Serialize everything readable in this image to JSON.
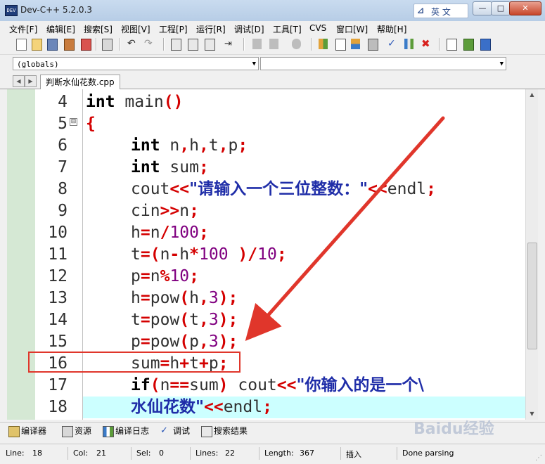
{
  "window": {
    "title": "Dev-C++ 5.2.0.3",
    "app_icon_text": "DEV",
    "ime_label": "英 文",
    "min": "—",
    "max": "□",
    "close": "✕"
  },
  "menu": [
    "文件[F]",
    "编辑[E]",
    "搜索[S]",
    "视图[V]",
    "工程[P]",
    "运行[R]",
    "调试[D]",
    "工具[T]",
    "CVS",
    "窗口[W]",
    "帮助[H]"
  ],
  "scope": {
    "class_combo": "(globals)",
    "member_combo": ""
  },
  "tabs": {
    "active_file": "判断水仙花数.cpp"
  },
  "editor": {
    "line_numbers": [
      "4",
      "5",
      "6",
      "7",
      "8",
      "9",
      "10",
      "11",
      "12",
      "13",
      "14",
      "15",
      "16",
      "17",
      "18"
    ],
    "fold_marker": "⊟",
    "lines": {
      "l4": {
        "kw": "int",
        "rest": " main",
        "op": "()"
      },
      "l5": {
        "op": "{"
      },
      "l6": {
        "kw": "int",
        "rest": " n",
        "op1": ",",
        "r2": "h",
        "op2": ",",
        "r3": "t",
        "op3": ",",
        "r4": "p",
        "op4": ";"
      },
      "l7": {
        "kw": "int",
        "rest": " sum",
        "op": ";"
      },
      "l8": {
        "rest": "cout",
        "op1": "<<",
        "str": "\"请输入一个三位整数：\"",
        "op2": "<<",
        "r2": "endl",
        "op3": ";"
      },
      "l9": {
        "rest": "cin",
        "op1": ">>",
        "r2": "n",
        "op2": ";"
      },
      "l10": {
        "rest": "h",
        "op1": "=",
        "r2": "n",
        "op2": "/",
        "num": "100",
        "op3": ";"
      },
      "l11": {
        "rest": "t",
        "op1": "=(",
        "r2": "n",
        "op2": "-",
        "r3": "h",
        "op3": "*",
        "num": "100",
        "r4": " ",
        "op4": ")/",
        "num2": "10",
        "op5": ";"
      },
      "l12": {
        "rest": "p",
        "op1": "=",
        "r2": "n",
        "op2": "%",
        "num": "10",
        "op3": ";"
      },
      "l13": {
        "rest": "h",
        "op1": "=",
        "r2": "pow",
        "op2": "(",
        "r3": "h",
        "op3": ",",
        "num": "3",
        "op4": ");"
      },
      "l14": {
        "rest": "t",
        "op1": "=",
        "r2": "pow",
        "op2": "(",
        "r3": "t",
        "op3": ",",
        "num": "3",
        "op4": ");"
      },
      "l15": {
        "rest": "p",
        "op1": "=",
        "r2": "pow",
        "op2": "(",
        "r3": "p",
        "op3": ",",
        "num": "3",
        "op4": ");"
      },
      "l16": {
        "rest": "sum",
        "op1": "=",
        "r2": "h",
        "op2": "+",
        "r3": "t",
        "op3": "+",
        "r4": "p",
        "op4": ";"
      },
      "l17": {
        "kw": "if",
        "op1": "(",
        "r2": "n",
        "op2": "==",
        "r3": "sum",
        "op3": ")",
        "r4": " cout",
        "op4": "<<",
        "str": "\"你输入的是一个\\"
      },
      "l18": {
        "str": "水仙花数\"",
        "op1": "<<",
        "r2": "endl",
        "op2": ";"
      }
    }
  },
  "bottom_tabs": [
    "编译器",
    "资源",
    "编译日志",
    "调试",
    "搜索结果"
  ],
  "watermark": "Baidu经验",
  "status": {
    "line_label": "Line:",
    "line_value": "18",
    "col_label": "Col:",
    "col_value": "21",
    "sel_label": "Sel:",
    "sel_value": "0",
    "lines_label": "Lines:",
    "lines_value": "22",
    "length_label": "Length:",
    "length_value": "367",
    "mode": "插入",
    "message": "Done parsing"
  },
  "colors": {
    "keyword": "#000000",
    "operator": "#d40000",
    "number": "#800080",
    "string": "#1f2da8",
    "current_line": "#ccffff",
    "gutter_band": "#d5e8d4",
    "annotation": "#e0362b"
  }
}
